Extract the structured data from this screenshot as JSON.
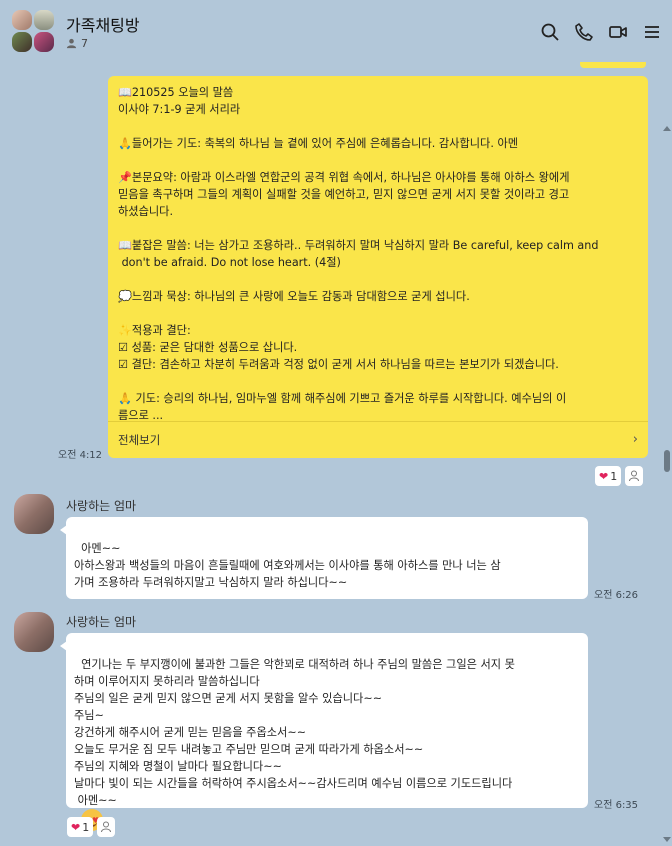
{
  "header": {
    "title": "가족채팅방",
    "member_count": "7",
    "icons": [
      "search-icon",
      "phone-icon",
      "video-call-icon",
      "menu-icon"
    ]
  },
  "notice": {
    "body": "📖210525 오늘의 말씀\n이사야 7:1-9 굳게 서리라\n\n🙏들어가는 기도: 축복의 하나님 늘 곁에 있어 주심에 은혜롭습니다. 감사합니다. 아멘\n\n📌본문요약: 아람과 이스라엘 연합군의 공격 위협 속에서, 하나님은 아사야를 통해 아하스 왕에게\n믿음을 촉구하며 그들의 계획이 실패할 것을 예언하고, 믿지 않으면 굳게 서지 못할 것이라고 경고\n하셨습니다.\n\n📖붙잡은 말씀: 너는 삼가고 조용하라.. 두려워하지 말며 낙심하지 말라 Be careful, keep calm and\n don't be afraid. Do not lose heart. (4절)\n\n💭느낌과 묵상: 하나님의 큰 사랑에 오늘도 감동과 담대함으로 굳게 섭니다.\n\n✨적용과 결단:\n☑ 성품: 굳은 담대한 성품으로 삽니다.\n☑ 결단: 겸손하고 차분히 두려움과 걱정 없이 굳게 서서 하나님을 따르는 본보기가 되겠습니다.\n\n🙏 기도: 승리의 하나님, 임마누엘 함께 해주심에 기쁘고 즐거운 하루를 시작합니다. 예수님의 이\n름으로 ...",
    "see_all": "전체보기",
    "time": "오전 4:12",
    "reaction_count": "1"
  },
  "messages": [
    {
      "sender": "사랑하는 엄마",
      "text": "아멘~~\n아하스왕과 백성들의 마음이 흔들릴때에 여호와께서는 이사야를 통해 아하스를 만나 너는 삼\n가며 조용하라 두려워하지말고 낙심하지 말라 하십니다~~",
      "time": "오전 6:26"
    },
    {
      "sender": "사랑하는 엄마",
      "text": "연기나는 두 부지깽이에 불과한 그들은 악한꾀로 대적하려 하나 주님의 말씀은 그일은 서지 못\n하며 이루어지지 못하리라 말씀하십니다\n주님의 일은 굳게 믿지 않으면 굳게 서지 못함을 알수 있습니다~~\n주님~\n강건하게 해주시어 굳게 믿는 믿음을 주옵소서~~\n오늘도 무거운 짐 모두 내려놓고 주님만 믿으며 굳게 따라가게 하옵소서~~\n주님의 지혜와 명철이 날마다 필요합니다~~\n날마다 빛이 되는 시간들을 허락하여 주시옵소서~~감사드리며 예수님 이름으로 기도드립니다\n 아멘~~",
      "emoji": "smiling-face-with-heart-eyes",
      "time": "오전 6:35",
      "reaction_count": "1"
    }
  ]
}
